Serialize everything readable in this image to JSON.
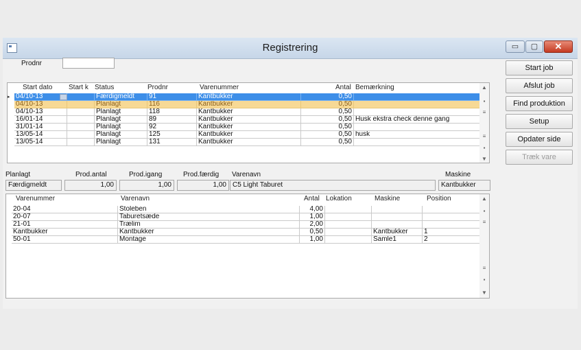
{
  "window": {
    "title": "Registrering"
  },
  "title_buttons": {
    "minimize": "▭",
    "maximize": "▢",
    "close": "✕"
  },
  "prodnr_filter": {
    "label": "Prodnr",
    "value": ""
  },
  "jobs_table": {
    "headers": [
      "Start dato",
      "Start k",
      "Status",
      "Prodnr",
      "Varenummer",
      "Antal",
      "Bemærkning"
    ],
    "rows": [
      [
        "04/10-13",
        "",
        "Færdigmeldt",
        "91",
        "Kantbukker",
        "0,50",
        ""
      ],
      [
        "04/10-13",
        "",
        "Planlagt",
        "116",
        "Kantbukker",
        "0,50",
        ""
      ],
      [
        "04/10-13",
        "",
        "Planlagt",
        "118",
        "Kantbukker",
        "0,50",
        ""
      ],
      [
        "16/01-14",
        "",
        "Planlagt",
        "89",
        "Kantbukker",
        "0,50",
        "Husk ekstra check denne gang"
      ],
      [
        "31/01-14",
        "",
        "Planlagt",
        "92",
        "Kantbukker",
        "0,50",
        ""
      ],
      [
        "13/05-14",
        "",
        "Planlagt",
        "125",
        "Kantbukker",
        "0,50",
        "husk"
      ],
      [
        "13/05-14",
        "",
        "Planlagt",
        "131",
        "Kantbukker",
        "0,50",
        ""
      ]
    ]
  },
  "detail": {
    "labels": {
      "planlagt": "Planlagt",
      "prod_antal": "Prod.antal",
      "prod_igang": "Prod.igang",
      "prod_faerdig": "Prod.færdig",
      "varenavn": "Varenavn",
      "maskine": "Maskine"
    },
    "values": {
      "planlagt": "Færdigmeldt",
      "prod_antal": "1,00",
      "prod_igang": "1,00",
      "prod_faerdig": "1,00",
      "varenavn": "C5 Light Taburet",
      "maskine": "Kantbukker"
    }
  },
  "items_table": {
    "headers": [
      "Varenummer",
      "Varenavn",
      "Antal",
      "Lokation",
      "Maskine",
      "Position"
    ],
    "rows": [
      [
        "20-04",
        "Stoleben",
        "4,00",
        "",
        "",
        ""
      ],
      [
        "20-07",
        "Taburetsæde",
        "1,00",
        "",
        "",
        ""
      ],
      [
        "21-01",
        "Trælim",
        "2,00",
        "",
        "",
        ""
      ],
      [
        "Kantbukker",
        "Kantbukker",
        "0,50",
        "",
        "Kantbukker",
        "1"
      ],
      [
        "50-01",
        "Montage",
        "1,00",
        "",
        "Samle1",
        "2"
      ]
    ]
  },
  "buttons": {
    "start_job": "Start job",
    "afslut_job": "Afslut job",
    "find_produktion": "Find produktion",
    "setup": "Setup",
    "opdater_side": "Opdater side",
    "traek_vare": "Træk vare"
  },
  "scroll_glyphs": {
    "up": "▲",
    "down": "▼",
    "thumb_top": "▪",
    "thumb_mid": "≡"
  }
}
